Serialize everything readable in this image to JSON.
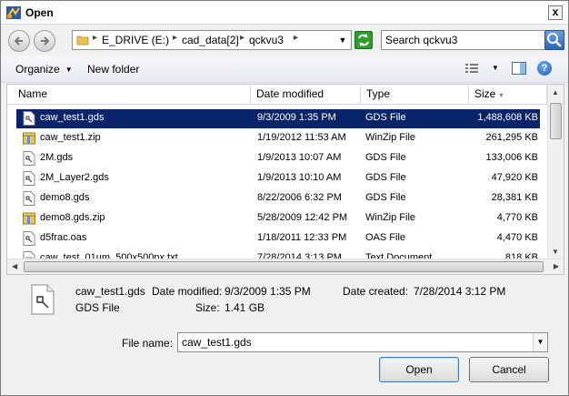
{
  "window": {
    "title": "Open",
    "close_label": "x"
  },
  "address": {
    "crumbs": [
      "E_DRIVE (E:)",
      "cad_data[2]",
      "qckvu3"
    ],
    "separator": "▸"
  },
  "search": {
    "placeholder": "Search qckvu3"
  },
  "toolbar": {
    "organize_label": "Organize",
    "new_folder_label": "New folder",
    "help_label": "?"
  },
  "columns": {
    "name": "Name",
    "date": "Date modified",
    "type": "Type",
    "size": "Size"
  },
  "files": [
    {
      "name": "caw_test1.gds",
      "date": "9/3/2009 1:35 PM",
      "type": "GDS File",
      "size": "1,488,608 KB",
      "icon": "gds-file-icon",
      "selected": true
    },
    {
      "name": "caw_test1.zip",
      "date": "1/19/2012 11:53 AM",
      "type": "WinZip File",
      "size": "261,295 KB",
      "icon": "zip-file-icon"
    },
    {
      "name": "2M.gds",
      "date": "1/9/2013 10:07 AM",
      "type": "GDS File",
      "size": "133,006 KB",
      "icon": "gds-file-icon"
    },
    {
      "name": "2M_Layer2.gds",
      "date": "1/9/2013 10:10 AM",
      "type": "GDS File",
      "size": "47,920 KB",
      "icon": "gds-file-icon"
    },
    {
      "name": "demo8.gds",
      "date": "8/22/2006 6:32 PM",
      "type": "GDS File",
      "size": "28,381 KB",
      "icon": "gds-file-icon"
    },
    {
      "name": "demo8.gds.zip",
      "date": "5/28/2009 12:42 PM",
      "type": "WinZip File",
      "size": "4,770 KB",
      "icon": "zip-file-icon"
    },
    {
      "name": "d5frac.oas",
      "date": "1/18/2011 12:33 PM",
      "type": "OAS File",
      "size": "4,470 KB",
      "icon": "oas-file-icon"
    },
    {
      "name": "caw_test_01um_500x500px.txt",
      "date": "7/28/2014 3:13 PM",
      "type": "Text Document",
      "size": "818 KB",
      "icon": "text-file-icon"
    }
  ],
  "details": {
    "name": "caw_test1.gds",
    "type": "GDS File",
    "modified_label": "Date modified:",
    "modified_value": "9/3/2009 1:35 PM",
    "created_label": "Date created:",
    "created_value": "7/28/2014 3:12 PM",
    "size_label": "Size:",
    "size_value": "1.41 GB"
  },
  "filename": {
    "label": "File name:",
    "value": "caw_test1.gds"
  },
  "buttons": {
    "open": "Open",
    "cancel": "Cancel"
  }
}
